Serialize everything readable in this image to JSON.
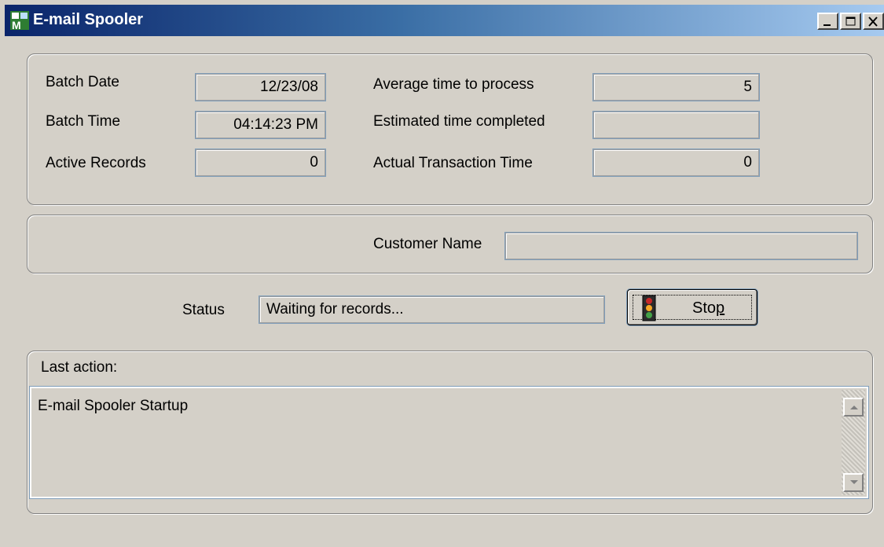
{
  "window": {
    "title": "E-mail Spooler",
    "icon": "mas-app-icon"
  },
  "stats": {
    "batch_date_label": "Batch Date",
    "batch_date": "12/23/08",
    "batch_time_label": "Batch Time",
    "batch_time": "04:14:23 PM",
    "active_records_label": "Active Records",
    "active_records": "0",
    "avg_time_label": "Average time to process",
    "avg_time": "5",
    "est_completed_label": "Estimated time completed",
    "est_completed": "",
    "actual_time_label": "Actual Transaction Time",
    "actual_time": "0"
  },
  "customer": {
    "label": "Customer Name",
    "value": ""
  },
  "status": {
    "label": "Status",
    "value": "Waiting for records..."
  },
  "stop_button": {
    "label_prefix": "Sto",
    "label_accel": "p",
    "icon": "traffic-light-icon"
  },
  "last_action": {
    "label": "Last action:",
    "entries": [
      "E-mail Spooler Startup"
    ]
  }
}
